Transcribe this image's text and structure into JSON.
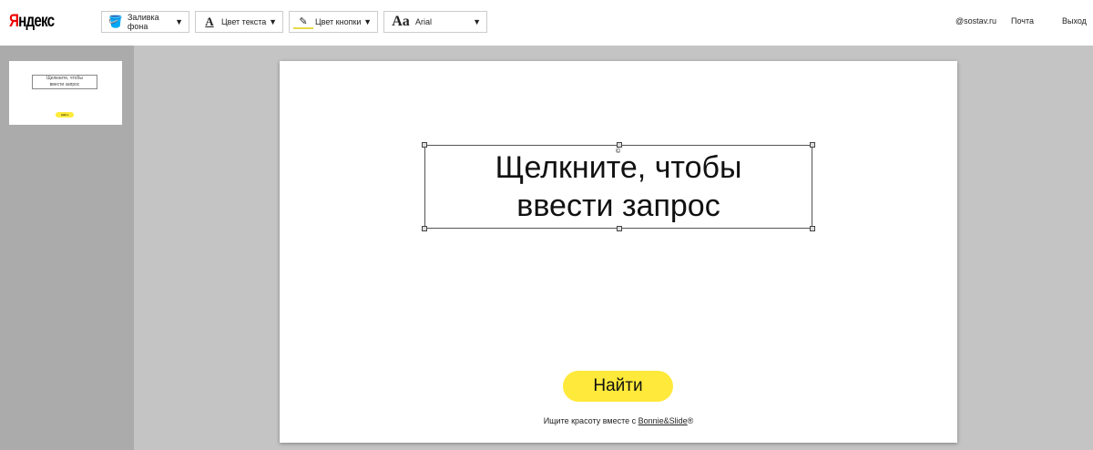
{
  "header": {
    "logo": "Яндекс",
    "logo_first": "Я",
    "logo_rest": "ндекс",
    "tools": [
      {
        "icon": "paint-bucket-icon",
        "label": "Заливка фона"
      },
      {
        "icon": "text-color-icon",
        "label": "Цвет текста"
      },
      {
        "icon": "brush-icon",
        "label": "Цвет кнопки"
      },
      {
        "icon": "font-icon",
        "label": "Arial",
        "glyph": "Aa"
      }
    ],
    "user": "@sostav.ru",
    "mail": "Почта",
    "logout": "Выход"
  },
  "slide": {
    "text_line1": "Щелкните, чтобы",
    "text_line2": "ввести запрос",
    "button": "Найти",
    "footer_prefix": "Ищите красоту вместе с ",
    "footer_link": "Bonnie&Slide",
    "footer_suffix": "®"
  },
  "thumb": {
    "text_line1": "Щелкните, чтобы",
    "text_line2": "ввести запрос",
    "button": "Найти"
  },
  "colors": {
    "accent": "#ffe93a",
    "logo_red": "#e00000"
  }
}
